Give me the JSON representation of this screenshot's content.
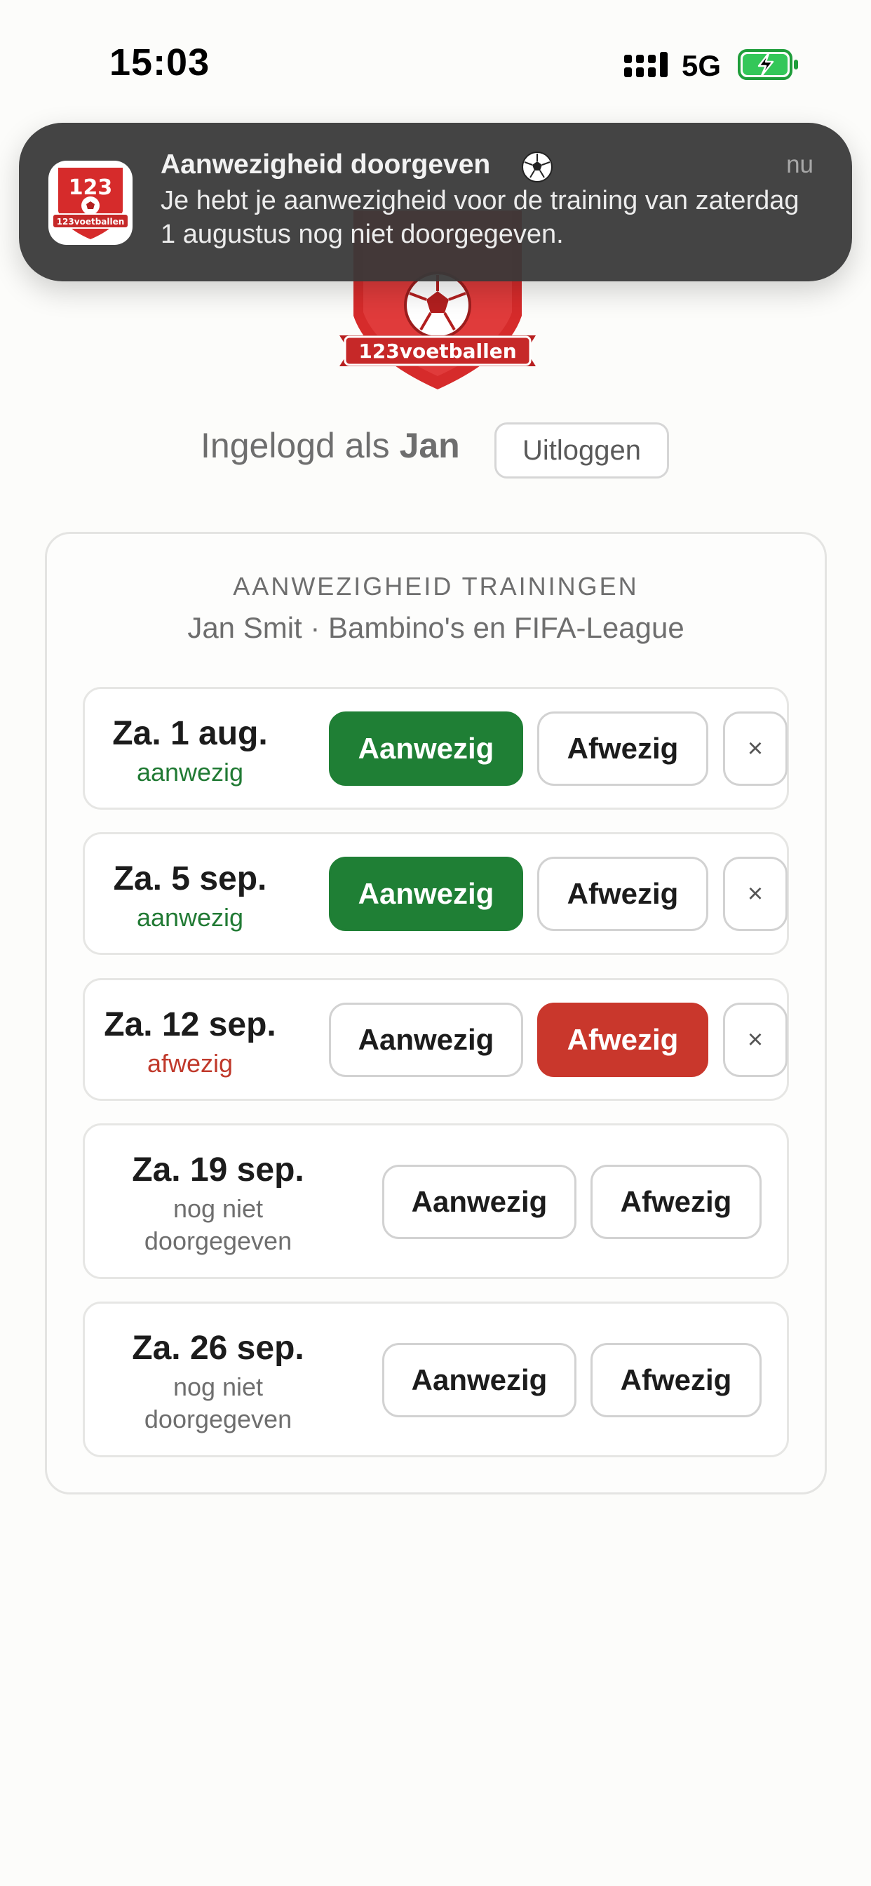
{
  "status_bar": {
    "time": "15:03",
    "network": "5G",
    "icons": [
      "signal-icon",
      "battery-charging-icon"
    ]
  },
  "notification": {
    "title": "Aanwezigheid doorgeven",
    "time": "nu",
    "body": "Je hebt je aanwezigheid voor de training van zaterdag 1 augustus nog niet doorgegeven.",
    "app_icon_text": "123",
    "app_icon_subtext": "123voetballen",
    "title_icon": "soccer-ball-icon"
  },
  "logo": {
    "text": "123voetballen"
  },
  "login": {
    "prefix": "Ingelogd als",
    "user": "Jan",
    "logout_label": "Uitloggen"
  },
  "attendance": {
    "heading": "AANWEZIGHEID TRAININGEN",
    "subheading": "Jan Smit · Bambino's en FIFA-League",
    "present_label": "Aanwezig",
    "absent_label": "Afwezig",
    "clear_label": "×",
    "rows": [
      {
        "date": "Za. 1 aug.",
        "status": "aanwezig"
      },
      {
        "date": "Za. 5 sep.",
        "status": "aanwezig"
      },
      {
        "date": "Za. 12 sep.",
        "status": "afwezig"
      },
      {
        "date": "Za. 19 sep.",
        "status": "nog niet doorgegeven",
        "status_line1": "nog niet",
        "status_line2": "doorgegeven"
      },
      {
        "date": "Za. 26 sep.",
        "status": "nog niet doorgegeven",
        "status_line1": "nog niet",
        "status_line2": "doorgegeven"
      }
    ]
  },
  "colors": {
    "present": "#1f7f35",
    "absent": "#c9372c",
    "brand_red": "#d62b2b",
    "notification_bg": "#383838"
  }
}
